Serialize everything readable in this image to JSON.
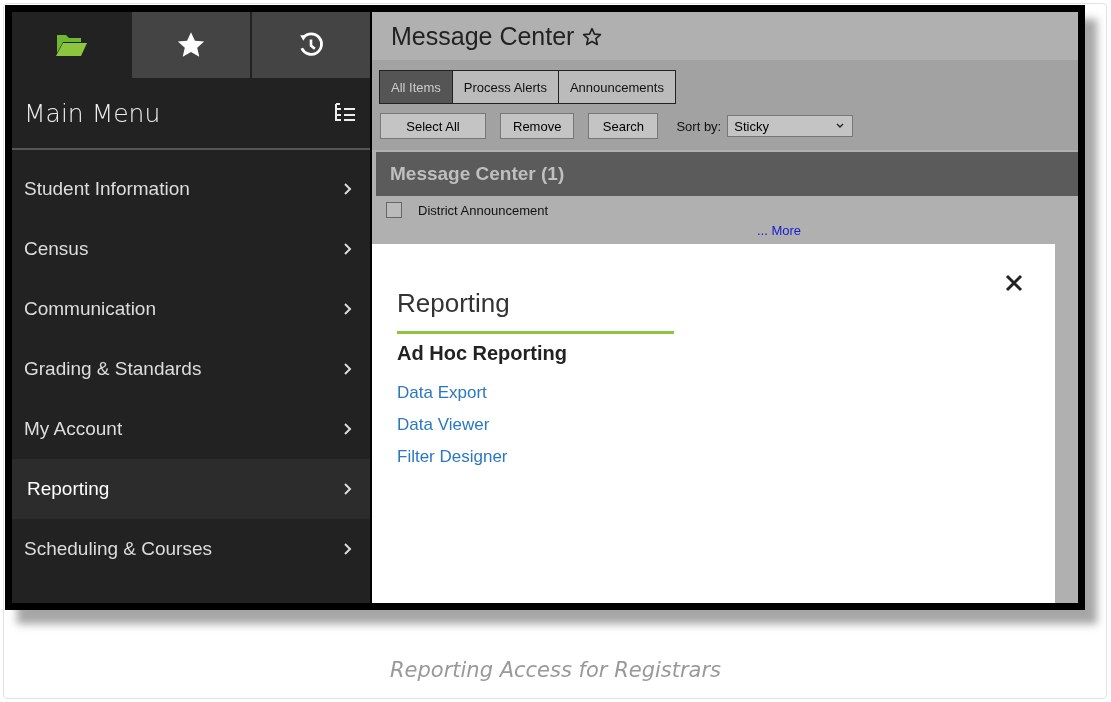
{
  "sidebar": {
    "tabs": [
      {
        "selected": true
      },
      {
        "selected": false
      },
      {
        "selected": false
      }
    ],
    "title": "Main Menu",
    "items": [
      {
        "label": "Student Information",
        "selected": false
      },
      {
        "label": "Census",
        "selected": false
      },
      {
        "label": "Communication",
        "selected": false
      },
      {
        "label": "Grading & Standards",
        "selected": false
      },
      {
        "label": "My Account",
        "selected": false
      },
      {
        "label": "Reporting",
        "selected": true
      },
      {
        "label": "Scheduling & Courses",
        "selected": false
      }
    ]
  },
  "main": {
    "title": "Message Center",
    "tabs": [
      {
        "label": "All Items",
        "selected": true
      },
      {
        "label": "Process Alerts",
        "selected": false
      },
      {
        "label": "Announcements",
        "selected": false
      }
    ],
    "buttons": [
      "Select All",
      "Remove",
      "Search"
    ],
    "sort": {
      "label": "Sort by:",
      "value": "Sticky"
    },
    "header": "Message Center (1)",
    "messages": [
      {
        "label": "District Announcement",
        "checked": false
      }
    ],
    "more": "... More"
  },
  "panel": {
    "title": "Reporting",
    "section": "Ad Hoc Reporting",
    "links": [
      "Data Export",
      "Data Viewer",
      "Filter Designer"
    ]
  },
  "caption": "Reporting Access for Registrars"
}
